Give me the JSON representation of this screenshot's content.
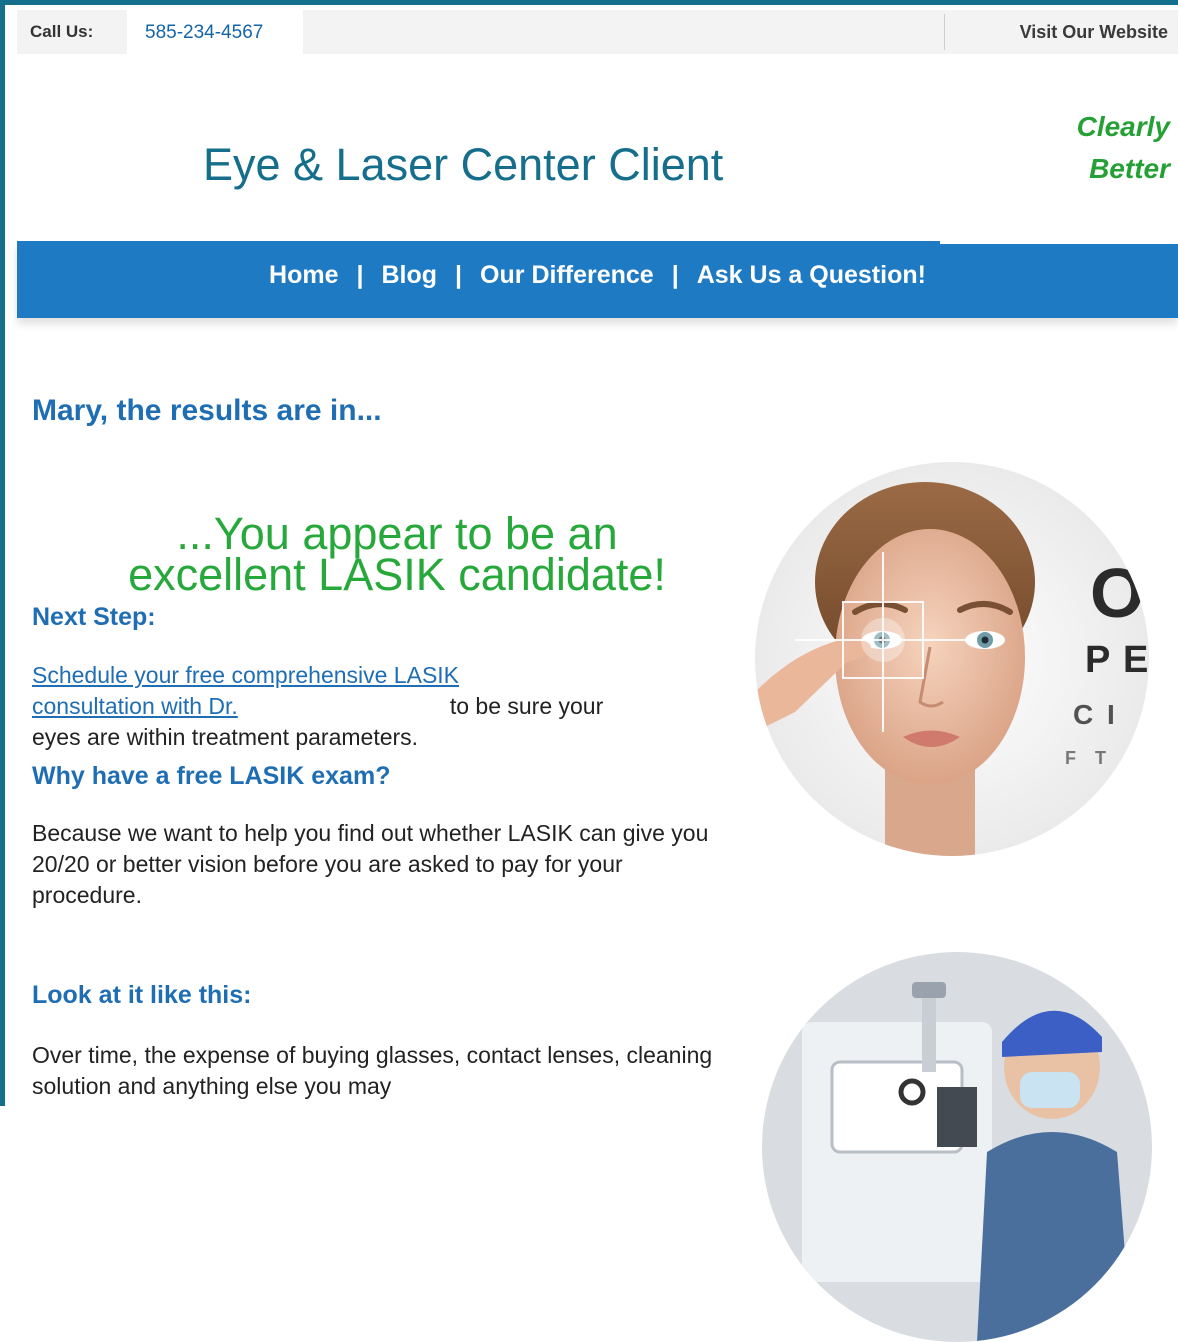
{
  "topbar": {
    "call_label": "Call Us:",
    "phone": "585-234-4567",
    "visit_label": "Visit Our Website"
  },
  "brand": {
    "title": "Eye & Laser Center Client",
    "tagline_line1": "Clearly",
    "tagline_line2": "Better"
  },
  "nav": {
    "items": [
      "Home",
      "Blog",
      "Our Difference",
      "Ask Us a Question!"
    ],
    "separator": "|"
  },
  "content": {
    "greeting": "Mary, the results are in...",
    "headline_line1": "...You appear to be an",
    "headline_line2": "excellent LASIK candidate!",
    "next_step_heading": "Next Step:",
    "schedule_link_line1": "Schedule your free comprehensive LASIK",
    "schedule_link_line2": "consultation with Dr.",
    "schedule_rest": "to be sure your",
    "schedule_rest_line2": "eyes are within treatment parameters.",
    "why_heading": "Why have a free LASIK exam?",
    "why_para": "Because we want to help you find out whether LASIK can give you 20/20 or better vision before you are asked to pay for your procedure.",
    "look_heading": "Look at it like this:",
    "look_para": "Over time, the expense of buying glasses, contact lenses, cleaning solution and anything else you may"
  },
  "colors": {
    "frame": "#156f8c",
    "nav": "#1f7ac4",
    "heading_blue": "#1f6eb4",
    "accent_green": "#27a83b",
    "title_teal": "#156f8c"
  },
  "icons": {
    "eye_image": "woman-eye-chart-image",
    "doctor_image": "doctor-equipment-image"
  }
}
